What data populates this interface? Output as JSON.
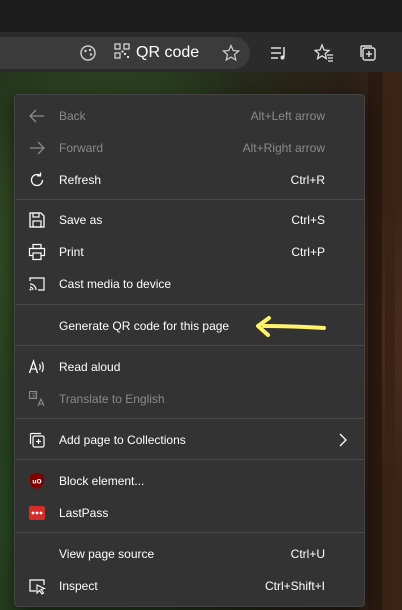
{
  "address_bar": {
    "qr_label": "QR code"
  },
  "menu": {
    "back": {
      "label": "Back",
      "shortcut": "Alt+Left arrow"
    },
    "forward": {
      "label": "Forward",
      "shortcut": "Alt+Right arrow"
    },
    "refresh": {
      "label": "Refresh",
      "shortcut": "Ctrl+R"
    },
    "save_as": {
      "label": "Save as",
      "shortcut": "Ctrl+S"
    },
    "print": {
      "label": "Print",
      "shortcut": "Ctrl+P"
    },
    "cast": {
      "label": "Cast media to device"
    },
    "qr": {
      "label": "Generate QR code for this page"
    },
    "read_aloud": {
      "label": "Read aloud"
    },
    "translate": {
      "label": "Translate to English"
    },
    "collections": {
      "label": "Add page to Collections"
    },
    "block": {
      "label": "Block element..."
    },
    "lastpass": {
      "label": "LastPass"
    },
    "view_source": {
      "label": "View page source",
      "shortcut": "Ctrl+U"
    },
    "inspect": {
      "label": "Inspect",
      "shortcut": "Ctrl+Shift+I"
    }
  },
  "colors": {
    "menu_bg": "#333333",
    "annotation": "#fff36b",
    "ublock_red": "#800000",
    "lastpass_red": "#d32d27"
  },
  "icons": {
    "extensions": "extensions-icon",
    "qr": "qr-code-icon",
    "favorite": "star-icon",
    "reading_list": "reading-list-icon",
    "favorites_bar": "favorites-icon",
    "collections": "collections-icon"
  }
}
